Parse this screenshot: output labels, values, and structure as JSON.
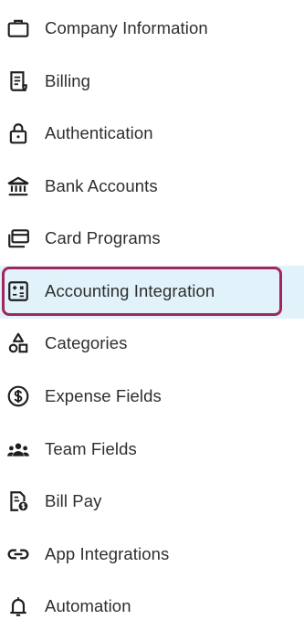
{
  "accent": {
    "active_border": "#a0275e",
    "active_background": "#e2f2fb",
    "text": "#2e2e2e",
    "icon": "#1f1f1f"
  },
  "sidebar": {
    "items": [
      {
        "label": "Company Information",
        "icon": "briefcase-icon",
        "active": false
      },
      {
        "label": "Billing",
        "icon": "receipt-icon",
        "active": false
      },
      {
        "label": "Authentication",
        "icon": "lock-icon",
        "active": false
      },
      {
        "label": "Bank Accounts",
        "icon": "bank-icon",
        "active": false
      },
      {
        "label": "Card Programs",
        "icon": "cards-icon",
        "active": false
      },
      {
        "label": "Accounting Integration",
        "icon": "calculator-icon",
        "active": true
      },
      {
        "label": "Categories",
        "icon": "shapes-icon",
        "active": false
      },
      {
        "label": "Expense Fields",
        "icon": "dollar-circle-icon",
        "active": false
      },
      {
        "label": "Team Fields",
        "icon": "team-icon",
        "active": false
      },
      {
        "label": "Bill Pay",
        "icon": "bill-icon",
        "active": false
      },
      {
        "label": "App Integrations",
        "icon": "link-icon",
        "active": false
      },
      {
        "label": "Automation",
        "icon": "bell-icon",
        "active": false
      }
    ]
  }
}
